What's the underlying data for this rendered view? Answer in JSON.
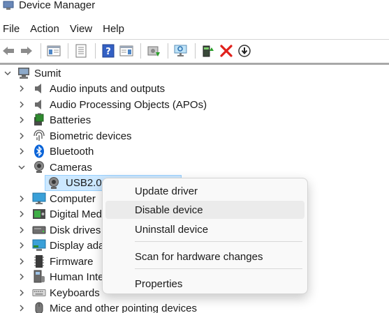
{
  "window": {
    "title": "Device Manager"
  },
  "menubar": {
    "items": [
      "File",
      "Action",
      "View",
      "Help"
    ]
  },
  "toolbar": {
    "icons": [
      "back-arrow-icon",
      "forward-arrow-icon",
      "show-hide-console-tree-icon",
      "properties-sheet-icon",
      "help-icon",
      "view-icon",
      "update-driver-icon",
      "scan-hardware-icon",
      "enable-device-icon",
      "uninstall-icon",
      "disable-device-icon"
    ]
  },
  "tree": {
    "root": "Sumit",
    "items": [
      {
        "label": "Audio inputs and outputs",
        "icon": "speaker-icon",
        "expanded": false
      },
      {
        "label": "Audio Processing Objects (APOs)",
        "icon": "speaker-icon",
        "expanded": false
      },
      {
        "label": "Batteries",
        "icon": "battery-icon",
        "expanded": false
      },
      {
        "label": "Biometric devices",
        "icon": "fingerprint-icon",
        "expanded": false
      },
      {
        "label": "Bluetooth",
        "icon": "bluetooth-icon",
        "expanded": false
      },
      {
        "label": "Cameras",
        "icon": "camera-icon",
        "expanded": true
      },
      {
        "label": "USB2.0 I",
        "icon": "webcam-icon",
        "child": true,
        "selected": true
      },
      {
        "label": "Computer",
        "icon": "monitor-icon",
        "expanded": false
      },
      {
        "label": "Digital Med",
        "icon": "media-icon",
        "expanded": false
      },
      {
        "label": "Disk drives",
        "icon": "disk-icon",
        "expanded": false
      },
      {
        "label": "Display ada",
        "icon": "display-adapter-icon",
        "expanded": false
      },
      {
        "label": "Firmware",
        "icon": "firmware-icon",
        "expanded": false
      },
      {
        "label": "Human Inte",
        "icon": "hid-icon",
        "expanded": false
      },
      {
        "label": "Keyboards",
        "icon": "keyboard-icon",
        "expanded": false
      },
      {
        "label": "Mice and other pointing devices",
        "icon": "mouse-icon",
        "expanded": false
      }
    ]
  },
  "context_menu": {
    "items": [
      {
        "label": "Update driver"
      },
      {
        "label": "Disable device",
        "hover": true
      },
      {
        "label": "Uninstall device"
      },
      {
        "label": "Scan for hardware changes"
      },
      {
        "label": "Properties"
      }
    ]
  },
  "colors": {
    "selection_bg": "#cce8ff",
    "selection_border": "#99d1ff",
    "menu_bg": "#f9f9f9",
    "hover_bg": "#ebebeb",
    "bluetooth_blue": "#0a64d8",
    "disable_red": "#e0201b"
  }
}
